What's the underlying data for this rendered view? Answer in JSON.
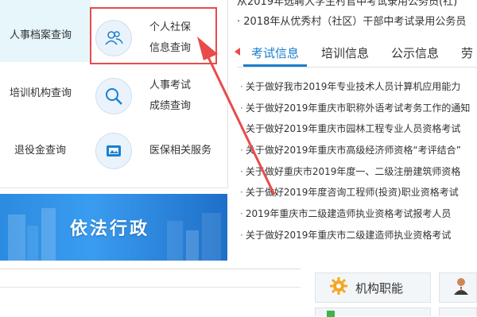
{
  "services": {
    "items": [
      {
        "label": "人事档案查询"
      },
      {
        "label_line1": "个人社保",
        "label_line2": "信息查询"
      },
      {
        "label": "培训机构查询"
      },
      {
        "label_line1": "人事考试",
        "label_line2": "成绩查询"
      },
      {
        "label": "退役金查询"
      },
      {
        "label": "医保相关服务"
      }
    ]
  },
  "banner": {
    "title": "依法行政"
  },
  "top_news": [
    "从2019年选聘大学生村官中考试录用公务员(社)",
    "· 2018年从优秀村（社区）干部中考试录用公务员"
  ],
  "tabs": [
    {
      "label": "考试信息",
      "active": true
    },
    {
      "label": "培训信息",
      "active": false
    },
    {
      "label": "公示信息",
      "active": false
    },
    {
      "label": "劳",
      "active": false
    }
  ],
  "news": [
    "关于做好我市2019年专业技术人员计算机应用能力",
    "关于做好2019年重庆市职称外语考试考务工作的通知",
    "关于做好2019年重庆市园林工程专业人员资格考试",
    "关于做好2019年重庆市高级经济师资格“考评结合”",
    "关于做好重庆市2019年度一、二级注册建筑师资格",
    "关于做好2019年度咨询工程师(投资)职业资格考试",
    "2019年重庆市二级建造师执业资格考试报考人员",
    "关于做好2019年重庆市二级建造师执业资格考试"
  ],
  "side_buttons": [
    {
      "label": "机构职能",
      "icon": "gear-icon"
    },
    {
      "label": "",
      "icon": "person-icon"
    }
  ],
  "colors": {
    "accent": "#1a7fd0",
    "highlight": "#e94b4b"
  }
}
